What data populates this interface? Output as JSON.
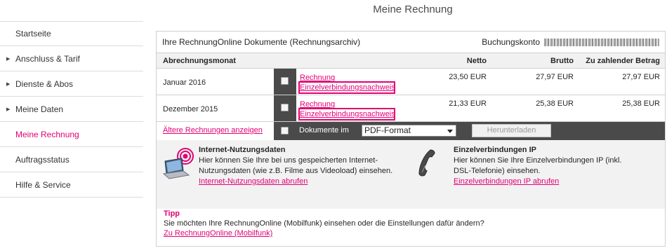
{
  "page_title": "Meine Rechnung",
  "sidebar": {
    "items": [
      {
        "label": "Startseite",
        "arrow": false,
        "active": false
      },
      {
        "label": "Anschluss & Tarif",
        "arrow": true,
        "active": false
      },
      {
        "label": "Dienste & Abos",
        "arrow": true,
        "active": false
      },
      {
        "label": "Meine Daten",
        "arrow": true,
        "active": false
      },
      {
        "label": "Meine Rechnung",
        "arrow": false,
        "active": true
      },
      {
        "label": "Auftragsstatus",
        "arrow": false,
        "active": false
      },
      {
        "label": "Hilfe & Service",
        "arrow": false,
        "active": false
      }
    ],
    "arrow_glyph": "▶"
  },
  "panel": {
    "title": "Ihre RechnungOnline Dokumente (Rechnungsarchiv)",
    "account_label": "Buchungskonto"
  },
  "table": {
    "headers": {
      "month": "Abrechnungsmonat",
      "net": "Netto",
      "gross": "Brutto",
      "due": "Zu zahlender Betrag"
    },
    "rows": [
      {
        "month": "Januar 2016",
        "link1": "Rechnung",
        "link2": "Einzelverbindungsnachweis",
        "net": "23,50 EUR",
        "gross": "27,97 EUR",
        "due": "27,97 EUR"
      },
      {
        "month": "Dezember 2015",
        "link1": "Rechnung",
        "link2": "Einzelverbindungsnachweis",
        "net": "21,33 EUR",
        "gross": "25,38 EUR",
        "due": "25,38 EUR"
      }
    ]
  },
  "actions": {
    "older_link": "Ältere Rechnungen anzeigen",
    "documents_label": "Dokumente im",
    "format_selected": "PDF-Format",
    "download_button": "Herunterladen"
  },
  "info": {
    "internet": {
      "title": "Internet-Nutzungsdaten",
      "line1": "Hier können Sie Ihre bei uns gespeicherten Internet-",
      "line2": "Nutzungsdaten (wie z.B. Filme aus Videoload) einsehen.",
      "link": "Internet-Nutzungsdaten abrufen"
    },
    "ip": {
      "title": "Einzelverbindungen IP",
      "line1": "Hier können Sie Ihre Einzelverbindungen IP (inkl.",
      "line2": "DSL-Telefonie) einsehen.",
      "link": "Einzelverbindungen IP abrufen"
    }
  },
  "tip": {
    "title": "Tipp",
    "text": "Sie möchten Ihre RechnungOnline (Mobilfunk) einsehen oder die Einstellungen dafür ändern?",
    "link": "Zu RechnungOnline (Mobilfunk)"
  },
  "colors": {
    "accent": "#e20074",
    "dark_bar": "#4a4a4a"
  }
}
